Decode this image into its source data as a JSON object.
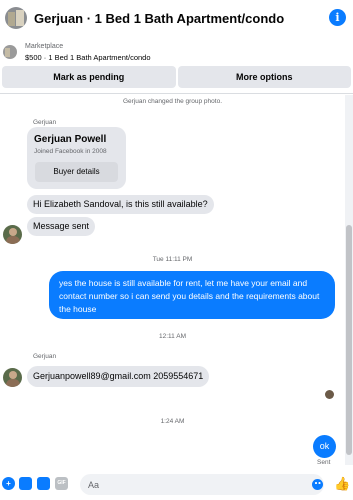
{
  "header": {
    "title": "Gerjuan · 1 Bed 1 Bath Apartment/condo",
    "info_icon": "i"
  },
  "marketplace": {
    "label": "Marketplace",
    "listing": "$500 · 1 Bed 1 Bath Apartment/condo"
  },
  "actions": {
    "mark_pending": "Mark as pending",
    "more_options": "More options"
  },
  "messages": {
    "group_photo_notice": "Gerjuan changed the group photo.",
    "sender_name_1": "Gerjuan",
    "card_name": "Gerjuan Powell",
    "card_joined": "Joined Facebook in 2008",
    "card_button": "Buyer details",
    "inquiry": "Hi Elizabeth Sandoval, is this still available?",
    "auto_reply": "Message sent",
    "timestamp_1": "Tue 11:11 PM",
    "reply_line_1": "yes the house is still available for rent, let me have your email  and",
    "reply_line_2": "contact number so i can send you details and the requirements about",
    "reply_line_3": "the house",
    "timestamp_2": "12:11 AM",
    "sender_name_2": "Gerjuan",
    "contact_info": "Gerjuanpowell89@gmail.com 2059554671",
    "timestamp_3": "1:24 AM",
    "ok_message": "ok",
    "sent_status": "Sent"
  },
  "composer": {
    "placeholder": "Aa",
    "add_icon": "+",
    "gif_label": "GIF"
  },
  "colors": {
    "accent": "#0a7cff",
    "bubble_gray": "#e4e6eb",
    "secondary_text": "#65676b"
  }
}
